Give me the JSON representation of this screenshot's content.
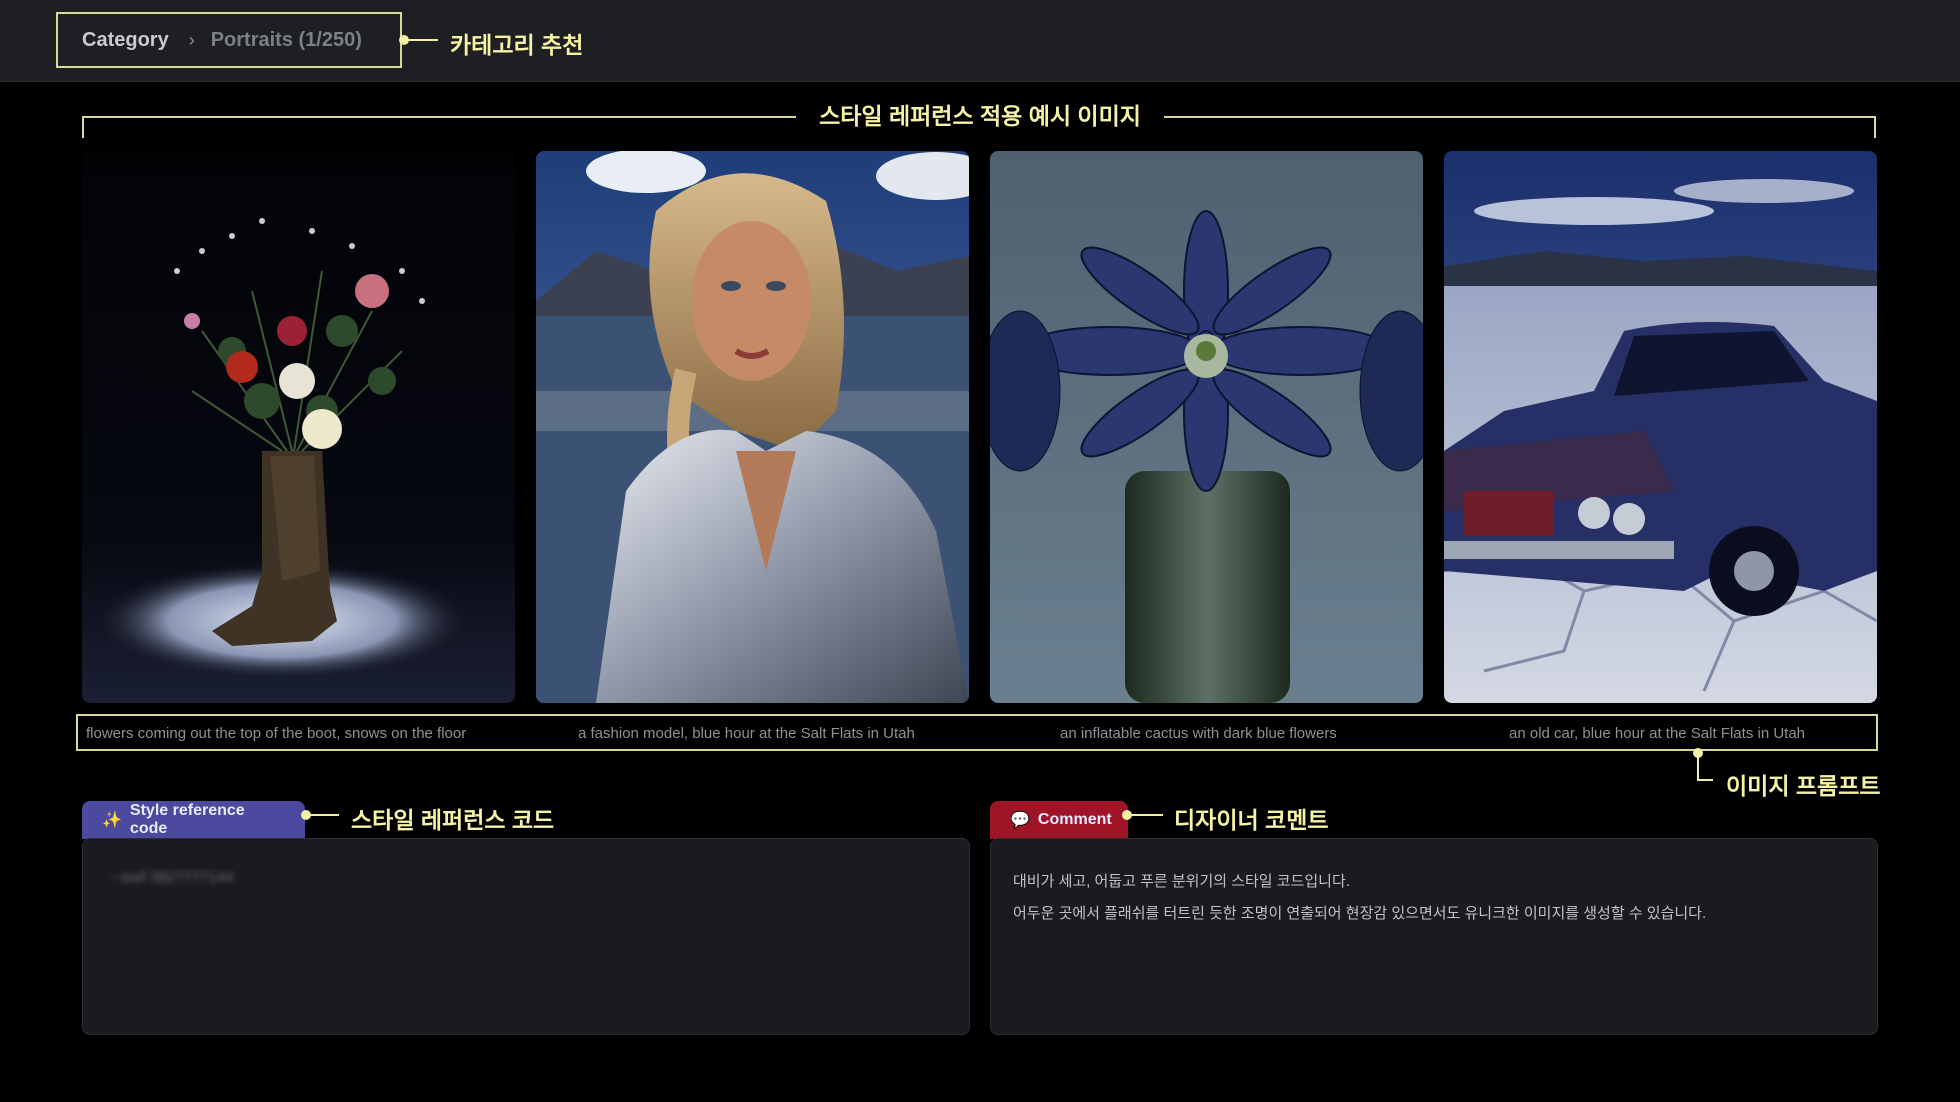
{
  "breadcrumb": {
    "category": "Category",
    "separator": "›",
    "current": "Portraits (1/250)"
  },
  "annotations": {
    "category_recommend": "카테고리 추천",
    "section_title": "스타일 레퍼런스 적용 예시 이미지",
    "image_prompt": "이미지 프롬프트",
    "style_reference_code": "스타일 레퍼런스 코드",
    "designer_comment": "디자이너 코멘트"
  },
  "gallery": [
    {
      "subject": "boot with flowers in snow"
    },
    {
      "subject": "fashion model in silver jacket"
    },
    {
      "subject": "inflatable cactus with dark blue flowers"
    },
    {
      "subject": "old car on salt flats"
    }
  ],
  "prompts": [
    "flowers coming out the top of the boot, snows on the floor",
    "a fashion model, blue hour at the Salt Flats in Utah",
    "an inflatable cactus with dark blue flowers",
    "an old car, blue hour at the Salt Flats in Utah"
  ],
  "style_ref": {
    "tab_label": "Style reference code",
    "code_blurred": "--sref 3827777144"
  },
  "comment": {
    "tab_label": "Comment",
    "lines": [
      "대비가 세고, 어둡고 푸른 분위기의 스타일 코드입니다.",
      "어두운 곳에서 플래쉬를 터트린 듯한 조명이 연출되어 현장감 있으면서도 유니크한 이미지를 생성할 수 있습니다."
    ]
  },
  "colors": {
    "accent_yellow": "#f3f0a4",
    "style_tab": "#4b4a9e",
    "comment_tab": "#a01428"
  }
}
